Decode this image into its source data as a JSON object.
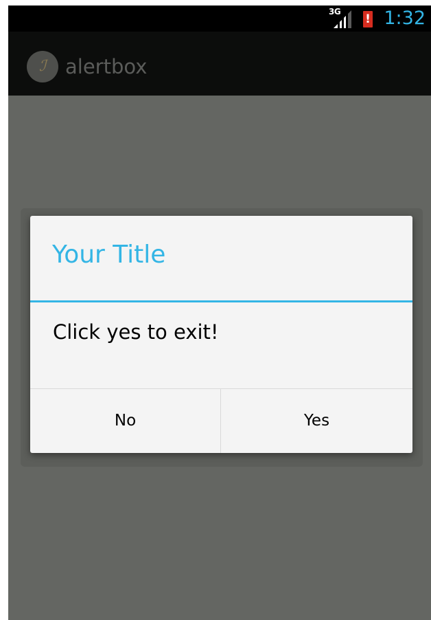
{
  "status_bar": {
    "network_type": "3G",
    "signal_icon": "signal-strength-icon",
    "battery_icon": "battery-alert-icon",
    "battery_alert_glyph": "!",
    "time": "1:32",
    "accent_color": "#33b5e5"
  },
  "action_bar": {
    "app_icon": "app-logo-icon",
    "app_icon_glyph": "ℐ",
    "title": "alertbox"
  },
  "dialog": {
    "title": "Your Title",
    "message": "Click yes to exit!",
    "negative_button": "No",
    "positive_button": "Yes",
    "accent_color": "#33b5e5"
  }
}
